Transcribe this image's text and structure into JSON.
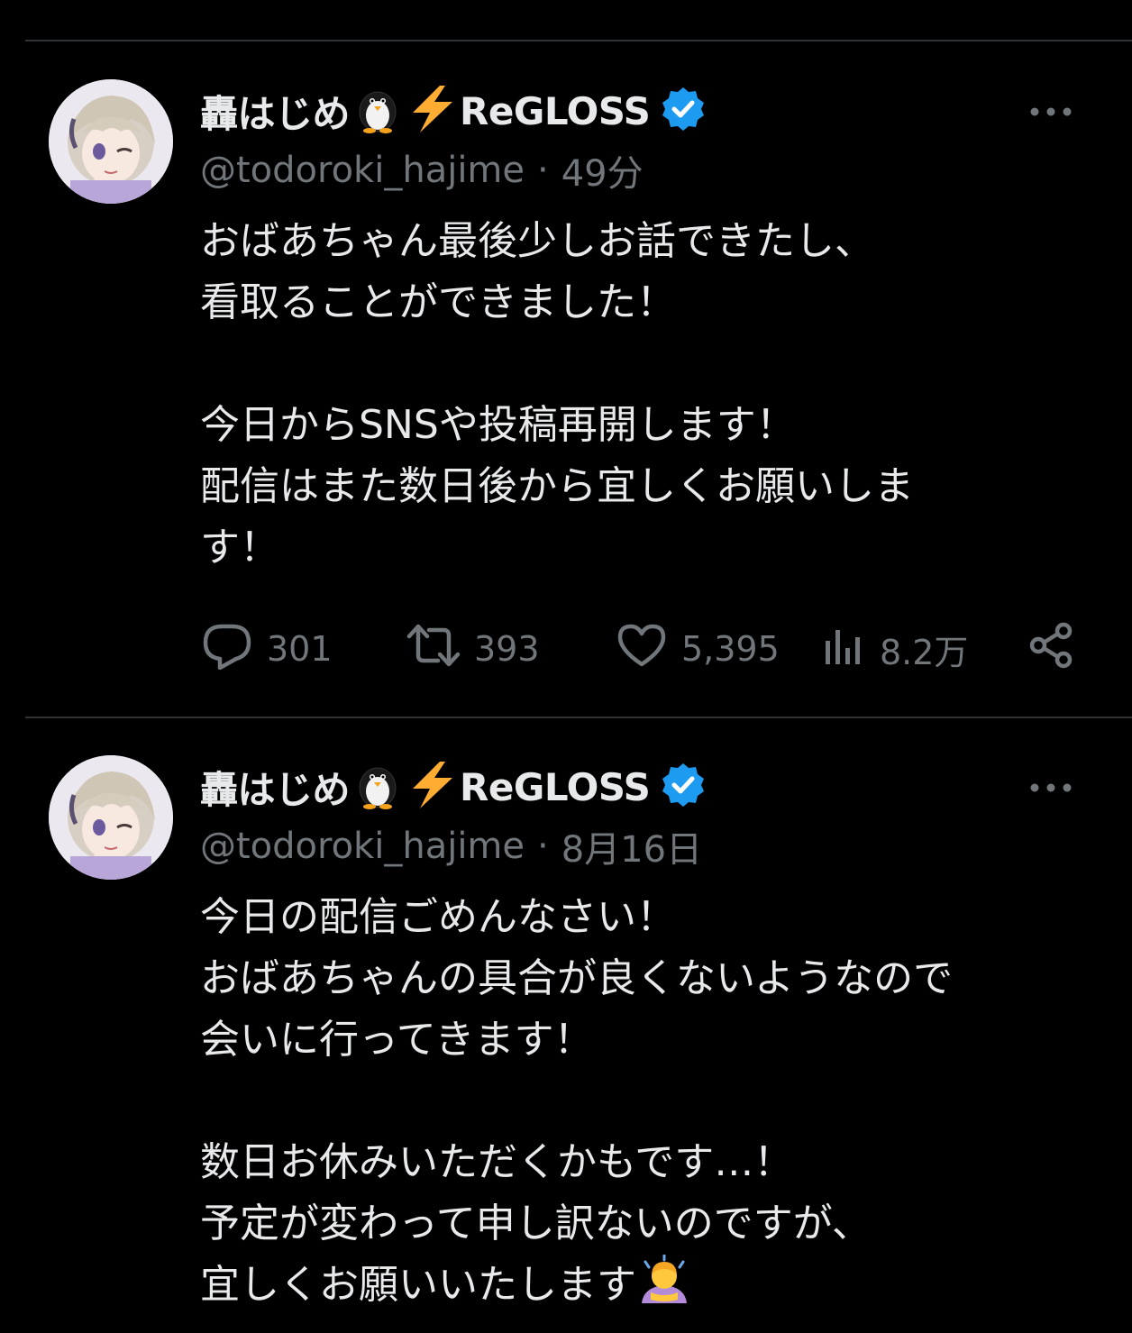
{
  "tweets": [
    {
      "display_name": "轟はじめ",
      "emoji_penguin": "penguin-icon",
      "emoji_bolt": "lightning-icon",
      "group": "ReGLOSS",
      "handle": "@todoroki_hajime",
      "separator": "·",
      "time": "49分",
      "lines": [
        "おばあちゃん最後少しお話できたし、",
        "看取ることができました！",
        "",
        "今日からSNSや投稿再開します！",
        "配信はまた数日後から宜しくお願いしま",
        "す！"
      ],
      "replies": "301",
      "retweets": "393",
      "likes": "5,395",
      "views": "8.2万"
    },
    {
      "display_name": "轟はじめ",
      "emoji_penguin": "penguin-icon",
      "emoji_bolt": "lightning-icon",
      "group": "ReGLOSS",
      "handle": "@todoroki_hajime",
      "separator": "·",
      "time": "8月16日",
      "lines": [
        "今日の配信ごめんなさい！",
        "おばあちゃんの具合が良くないようなので",
        "会いに行ってきます！",
        "",
        "数日お休みいただくかもです…！",
        "予定が変わって申し訳ないのですが、",
        "宜しくお願いいたします"
      ],
      "trailing_emoji": "person-bowing-icon"
    }
  ],
  "colors": {
    "background": "#000000",
    "text": "#e7e9ea",
    "muted": "#71767b",
    "divider": "#2f3336",
    "verified": "#1d9bf0",
    "bolt": "#ffac33"
  }
}
